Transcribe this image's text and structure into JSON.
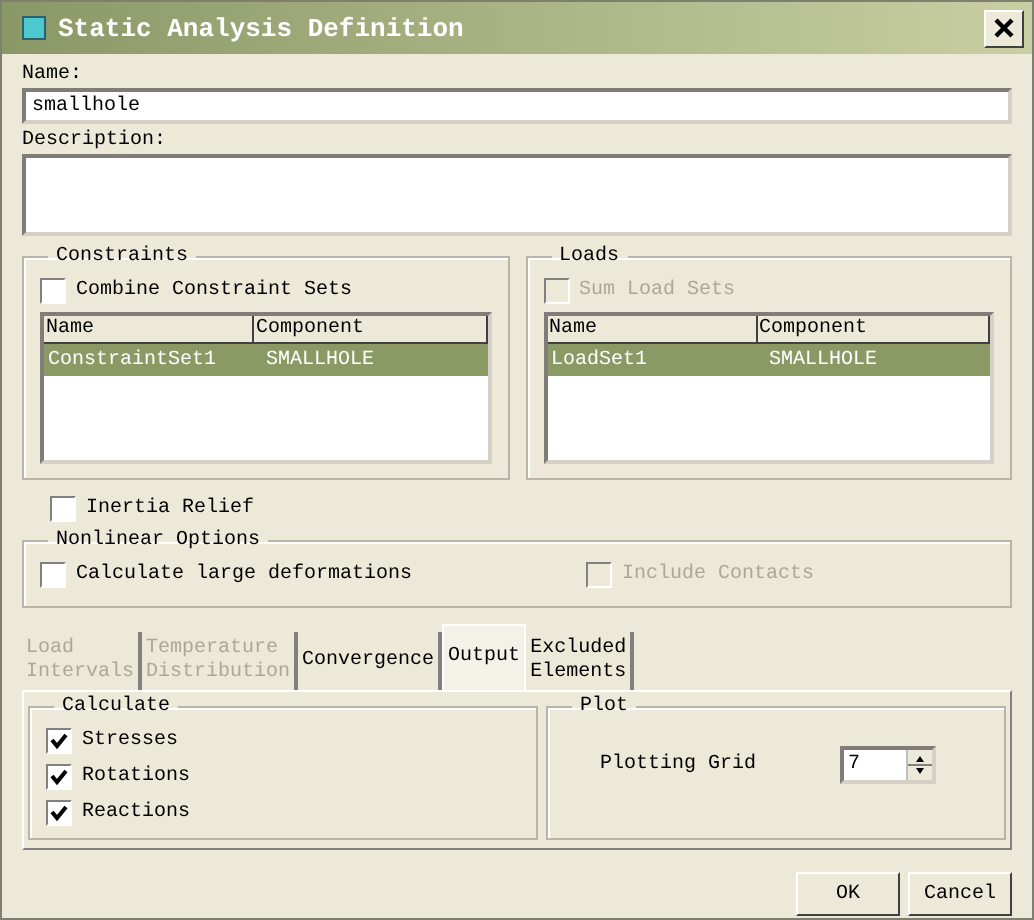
{
  "window": {
    "title": "Static Analysis Definition"
  },
  "name_field": {
    "label": "Name:",
    "value": "smallhole"
  },
  "description_field": {
    "label": "Description:"
  },
  "groups": [
    {
      "title": "Constraints",
      "checkbox": {
        "label": "Combine Constraint Sets",
        "checked": false,
        "disabled": false
      },
      "table": {
        "columns": [
          "Name",
          "Component"
        ],
        "rows": [
          {
            "cells": [
              "ConstraintSet1",
              "SMALLHOLE"
            ],
            "selected": true
          }
        ]
      }
    },
    {
      "title": "Loads",
      "checkbox": {
        "label": "Sum Load Sets",
        "checked": false,
        "disabled": true
      },
      "table": {
        "columns": [
          "Name",
          "Component"
        ],
        "rows": [
          {
            "cells": [
              "LoadSet1",
              "SMALLHOLE"
            ],
            "selected": true
          }
        ]
      }
    }
  ],
  "inertia_relief": {
    "label": "Inertia Relief",
    "checked": false,
    "disabled": false
  },
  "nonlinear_options": {
    "title": "Nonlinear Options",
    "options": [
      {
        "label": "Calculate large deformations",
        "checked": false,
        "disabled": false
      },
      {
        "label": "Include Contacts",
        "checked": false,
        "disabled": true
      }
    ]
  },
  "tabs": [
    {
      "lines": [
        "Load",
        "Intervals"
      ],
      "selected": false,
      "disabled": true
    },
    {
      "lines": [
        "Temperature",
        "Distribution"
      ],
      "selected": false,
      "disabled": true
    },
    {
      "lines": [
        "Convergence"
      ],
      "selected": false,
      "disabled": false
    },
    {
      "lines": [
        "Output"
      ],
      "selected": true,
      "disabled": false
    },
    {
      "lines": [
        "Excluded",
        "Elements"
      ],
      "selected": false,
      "disabled": false
    }
  ],
  "calculate": {
    "title": "Calculate",
    "items": [
      {
        "label": "Stresses",
        "checked": true
      },
      {
        "label": "Rotations",
        "checked": true
      },
      {
        "label": "Reactions",
        "checked": true
      }
    ]
  },
  "plot": {
    "title": "Plot",
    "plotting_grid": {
      "label": "Plotting Grid",
      "value": "7"
    }
  },
  "buttons": [
    "OK",
    "Cancel"
  ]
}
